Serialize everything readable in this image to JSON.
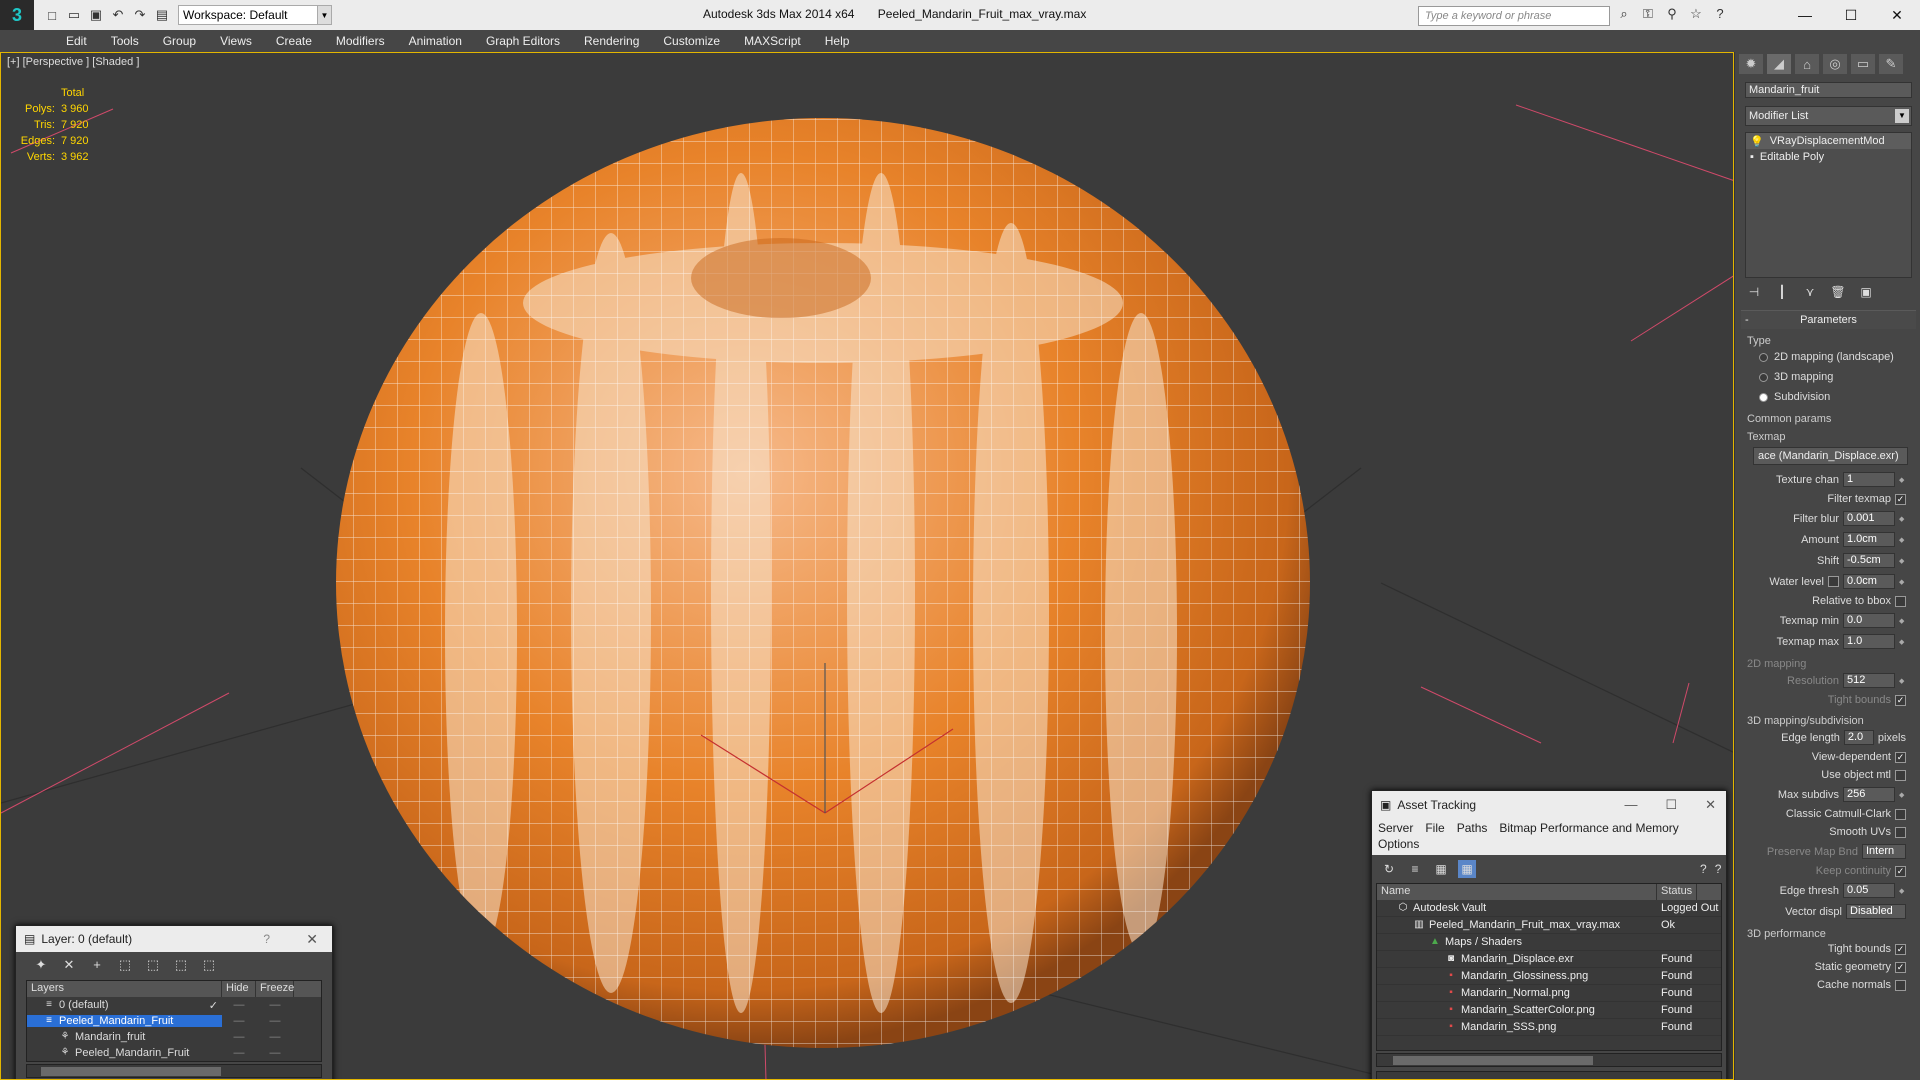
{
  "app": {
    "title": "Autodesk 3ds Max 2014 x64",
    "file": "Peeled_Mandarin_Fruit_max_vray.max",
    "workspace": "Workspace: Default",
    "search_placeholder": "Type a keyword or phrase"
  },
  "menu": [
    "Edit",
    "Tools",
    "Group",
    "Views",
    "Create",
    "Modifiers",
    "Animation",
    "Graph Editors",
    "Rendering",
    "Customize",
    "MAXScript",
    "Help"
  ],
  "viewport": {
    "label": "[+] [Perspective ] [Shaded ]",
    "stats": {
      "header": "Total",
      "rows": [
        {
          "label": "Polys:",
          "value": "3 960"
        },
        {
          "label": "Tris:",
          "value": "7 920"
        },
        {
          "label": "Edges:",
          "value": "7 920"
        },
        {
          "label": "Verts:",
          "value": "3 962"
        }
      ]
    }
  },
  "command_panel": {
    "object_name": "Mandarin_fruit",
    "modifier_list": "Modifier List",
    "stack": [
      "VRayDisplacementMod",
      "Editable Poly"
    ],
    "parameters_title": "Parameters",
    "type_group": "Type",
    "type_options": [
      "2D mapping (landscape)",
      "3D mapping",
      "Subdivision"
    ],
    "common_params": "Common params",
    "texmap_label": "Texmap",
    "texmap_value": "ace (Mandarin_Displace.exr)",
    "fields": {
      "texture_chan": {
        "label": "Texture chan",
        "value": "1"
      },
      "filter_texmap": {
        "label": "Filter texmap"
      },
      "filter_blur": {
        "label": "Filter blur",
        "value": "0.001"
      },
      "amount": {
        "label": "Amount",
        "value": "1.0cm"
      },
      "shift": {
        "label": "Shift",
        "value": "-0.5cm"
      },
      "water_level": {
        "label": "Water level",
        "value": "0.0cm"
      },
      "relative_bbox": {
        "label": "Relative to bbox"
      },
      "texmap_min": {
        "label": "Texmap min",
        "value": "0.0"
      },
      "texmap_max": {
        "label": "Texmap max",
        "value": "1.0"
      }
    },
    "mapping2d_title": "2D mapping",
    "resolution": {
      "label": "Resolution",
      "value": "512"
    },
    "tight_bounds": "Tight bounds",
    "mapping3d_title": "3D mapping/subdivision",
    "edge_length": {
      "label": "Edge length",
      "value": "2.0",
      "unit": "pixels"
    },
    "view_dependent": "View-dependent",
    "use_object_mtl": "Use object mtl",
    "max_subdivs": {
      "label": "Max subdivs",
      "value": "256"
    },
    "classic_catmull": "Classic Catmull-Clark",
    "smooth_uvs": "Smooth UVs",
    "preserve_map": {
      "label": "Preserve Map Bnd",
      "value": "Intern"
    },
    "keep_continuity": "Keep continuity",
    "edge_thresh": {
      "label": "Edge thresh",
      "value": "0.05"
    },
    "vector_displ": {
      "label": "Vector displ",
      "value": "Disabled"
    },
    "perf_title": "3D performance",
    "perf_tight_bounds": "Tight bounds",
    "static_geometry": "Static geometry",
    "cache_normals": "Cache normals"
  },
  "layer_window": {
    "title": "Layer: 0 (default)",
    "help": "?",
    "columns": [
      "Layers",
      "Hide",
      "Freeze"
    ],
    "rows": [
      {
        "name": "0 (default)",
        "indent": 0
      },
      {
        "name": "Peeled_Mandarin_Fruit",
        "indent": 0,
        "selected": true
      },
      {
        "name": "Mandarin_fruit",
        "indent": 1
      },
      {
        "name": "Peeled_Mandarin_Fruit",
        "indent": 1
      }
    ]
  },
  "asset_window": {
    "title": "Asset Tracking",
    "menu": [
      "Server",
      "File",
      "Paths",
      "Bitmap Performance and Memory",
      "Options"
    ],
    "columns": [
      "Name",
      "Status"
    ],
    "rows": [
      {
        "name": "Autodesk Vault",
        "status": "Logged Out",
        "indent": 1,
        "icon": "vault-icon"
      },
      {
        "name": "Peeled_Mandarin_Fruit_max_vray.max",
        "status": "Ok",
        "indent": 2,
        "icon": "max-file-icon"
      },
      {
        "name": "Maps / Shaders",
        "status": "",
        "indent": 3,
        "icon": "maps-icon"
      },
      {
        "name": "Mandarin_Displace.exr",
        "status": "Found",
        "indent": 4,
        "icon": "exr-icon"
      },
      {
        "name": "Mandarin_Glossiness.png",
        "status": "Found",
        "indent": 4,
        "icon": "png-icon"
      },
      {
        "name": "Mandarin_Normal.png",
        "status": "Found",
        "indent": 4,
        "icon": "png-icon"
      },
      {
        "name": "Mandarin_ScatterColor.png",
        "status": "Found",
        "indent": 4,
        "icon": "png-icon"
      },
      {
        "name": "Mandarin_SSS.png",
        "status": "Found",
        "indent": 4,
        "icon": "png-icon"
      }
    ]
  },
  "colors": {
    "stats": "#ffd600",
    "selection": "#2a6fd6",
    "fruit": "#e8832a",
    "fruit_light": "#f4c99a"
  }
}
